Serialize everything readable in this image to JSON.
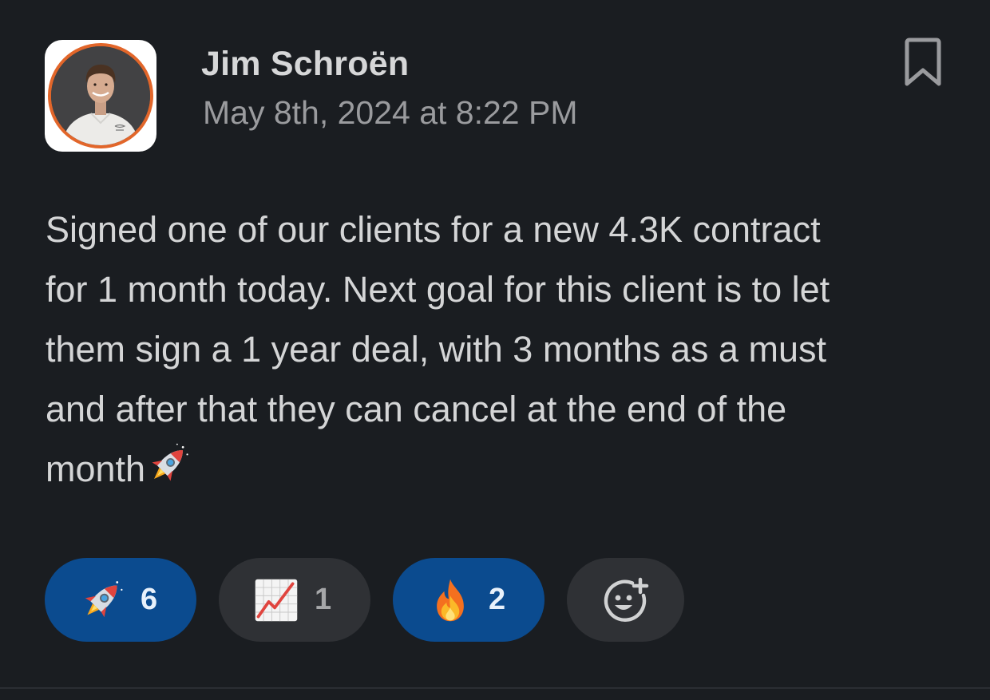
{
  "message": {
    "author": "Jim Schroën",
    "timestamp": "May 8th, 2024 at 8:22 PM",
    "body_lines": [
      "Signed one of our clients for a new 4.3K contract",
      "for 1 month today. Next goal for this client is to let",
      "them sign a 1 year deal, with 3 months as a must",
      "and after that they can cancel at the end of the",
      "month"
    ],
    "trailing_emoji": "rocket-icon"
  },
  "reactions": [
    {
      "emoji": "rocket-icon",
      "count": "6",
      "active": true
    },
    {
      "emoji": "chart-increasing-icon",
      "count": "1",
      "active": false
    },
    {
      "emoji": "fire-icon",
      "count": "2",
      "active": true
    }
  ],
  "colors": {
    "background": "#1a1d21",
    "active_reaction": "#0b4b8f",
    "inactive_reaction": "#2f3135",
    "avatar_ring": "#e2662a"
  }
}
